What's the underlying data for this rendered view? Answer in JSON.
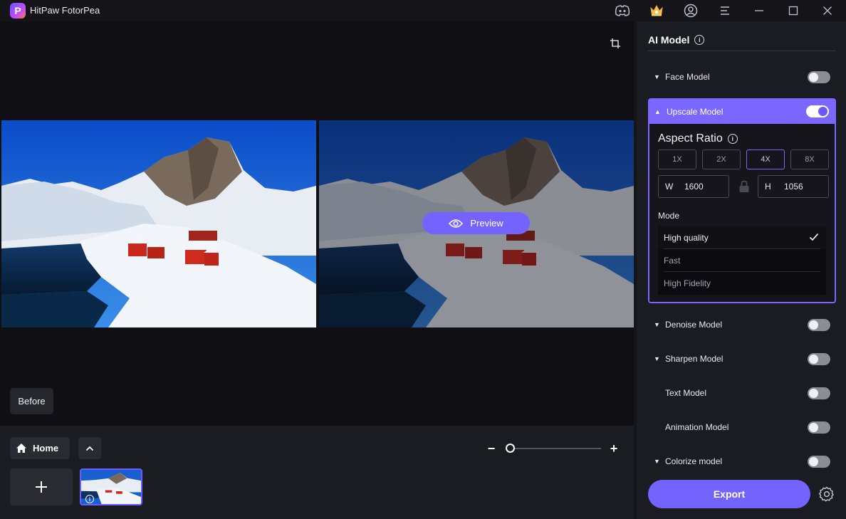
{
  "app": {
    "title": "HitPaw FotorPea",
    "logo_letter": "P"
  },
  "canvas": {
    "preview_label": "Preview",
    "before_label": "Before"
  },
  "bottombar": {
    "home_label": "Home",
    "zoom_minus": "−",
    "zoom_plus": "+",
    "thumb_info": "i"
  },
  "sidebar": {
    "title": "AI Model",
    "models": {
      "face": {
        "label": "Face Model",
        "enabled": false
      },
      "upscale": {
        "label": "Upscale Model",
        "enabled": true
      },
      "denoise": {
        "label": "Denoise Model",
        "enabled": false
      },
      "sharpen": {
        "label": "Sharpen Model",
        "enabled": false
      },
      "text": {
        "label": "Text Model",
        "enabled": false
      },
      "animation": {
        "label": "Animation Model",
        "enabled": false
      },
      "colorize": {
        "label": "Colorize model",
        "enabled": false
      }
    },
    "aspect_ratio": {
      "title": "Aspect Ratio",
      "options": [
        "1X",
        "2X",
        "4X",
        "8X"
      ],
      "selected": "4X",
      "width_label": "W",
      "width_value": "1600",
      "height_label": "H",
      "height_value": "1056"
    },
    "mode": {
      "label": "Mode",
      "options": [
        "High quality",
        "Fast",
        "High Fidelity"
      ],
      "selected": "High quality"
    },
    "export_label": "Export"
  },
  "colors": {
    "accent": "#7563ff",
    "bg": "#141419",
    "panel": "#1b1b22"
  }
}
